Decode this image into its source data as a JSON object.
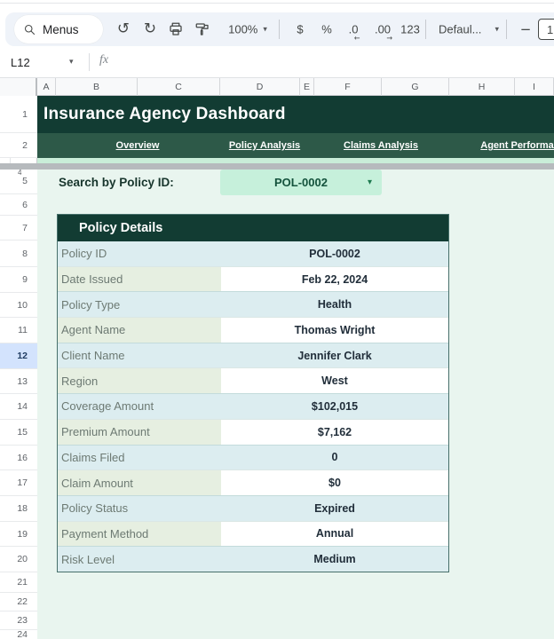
{
  "colors": {
    "dark_green": "#123c33",
    "nav_green": "#2d5948",
    "mint_bg": "#e9f5ef",
    "strip_green": "#c9edd8",
    "dropdown_bg": "#c6f0db",
    "dropdown_text": "#14523c",
    "dropdown_caret": "#1d7a4f",
    "row_blue": "#dcedf0",
    "row_green_label": "#e6efe1",
    "value_text": "#212e3a",
    "label_text": "#6d7a73",
    "table_border": "#47706b",
    "selected_row_bg": "#d3e3fd",
    "selected_row_text": "#1e3a5f",
    "toolbar_bg": "#eff3f9",
    "icon_color": "#444746",
    "search_label_text": "#17352c"
  },
  "toolbar": {
    "menus_label": "Menus",
    "zoom_value": "100%",
    "currency_label": "$",
    "percent_label": "%",
    "decrease_decimal_label": ".0",
    "increase_decimal_label": ".00",
    "more_formats_label": "123",
    "font_label": "Defaul...",
    "decrease_font_size_label": "−",
    "font_size_value": "1",
    "undo_glyph": "↺",
    "redo_glyph": "↻",
    "caret_glyph": "▾"
  },
  "formula_bar": {
    "name_box_value": "L12",
    "fx_label": "fx"
  },
  "grid": {
    "column_headers": [
      "A",
      "B",
      "C",
      "D",
      "E",
      "F",
      "G",
      "H",
      "I"
    ],
    "row_numbers_top": [
      "1",
      "2"
    ],
    "hidden_row_marker": "4",
    "row_numbers_main": [
      "5",
      "6",
      "7",
      "8",
      "9",
      "10",
      "11",
      "12",
      "13",
      "14",
      "15",
      "16",
      "17",
      "18",
      "19",
      "20",
      "21",
      "22",
      "23",
      "24"
    ],
    "selected_row": "12"
  },
  "sheet": {
    "title": "Insurance Agency Dashboard",
    "nav_links": [
      "Overview",
      "Policy Analysis",
      "Claims Analysis",
      "Agent Performance"
    ],
    "search_label": "Search by Policy ID:",
    "search_value": "POL-0002",
    "table": {
      "header": "Policy Details",
      "rows": [
        {
          "label": "Policy ID",
          "value": "POL-0002"
        },
        {
          "label": "Date Issued",
          "value": "Feb 22, 2024"
        },
        {
          "label": "Policy Type",
          "value": "Health"
        },
        {
          "label": "Agent Name",
          "value": "Thomas Wright"
        },
        {
          "label": "Client Name",
          "value": "Jennifer Clark"
        },
        {
          "label": "Region",
          "value": "West"
        },
        {
          "label": "Coverage Amount",
          "value": "$102,015"
        },
        {
          "label": "Premium Amount",
          "value": "$7,162"
        },
        {
          "label": "Claims Filed",
          "value": "0"
        },
        {
          "label": "Claim Amount",
          "value": "$0"
        },
        {
          "label": "Policy Status",
          "value": "Expired"
        },
        {
          "label": "Payment Method",
          "value": "Annual"
        },
        {
          "label": "Risk Level",
          "value": "Medium"
        }
      ]
    }
  }
}
